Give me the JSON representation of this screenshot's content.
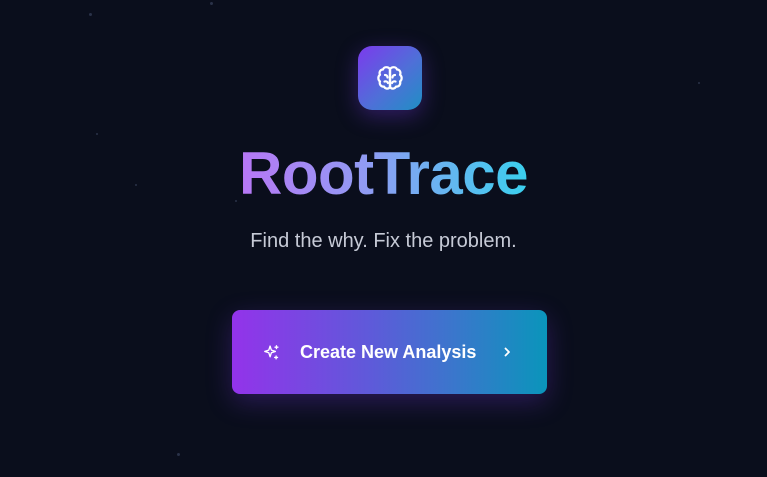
{
  "app": {
    "name": "RootTrace",
    "tagline": "Find the why. Fix the problem."
  },
  "logo": {
    "icon": "brain-icon"
  },
  "cta": {
    "label": "Create New Analysis",
    "leading_icon": "sparkles-icon",
    "trailing_icon": "chevron-right-icon"
  },
  "theme": {
    "background": "#0a0e1c",
    "accent_purple": "#9333ea",
    "accent_cyan": "#0a95bb",
    "tagline_color": "#c6cad6"
  }
}
